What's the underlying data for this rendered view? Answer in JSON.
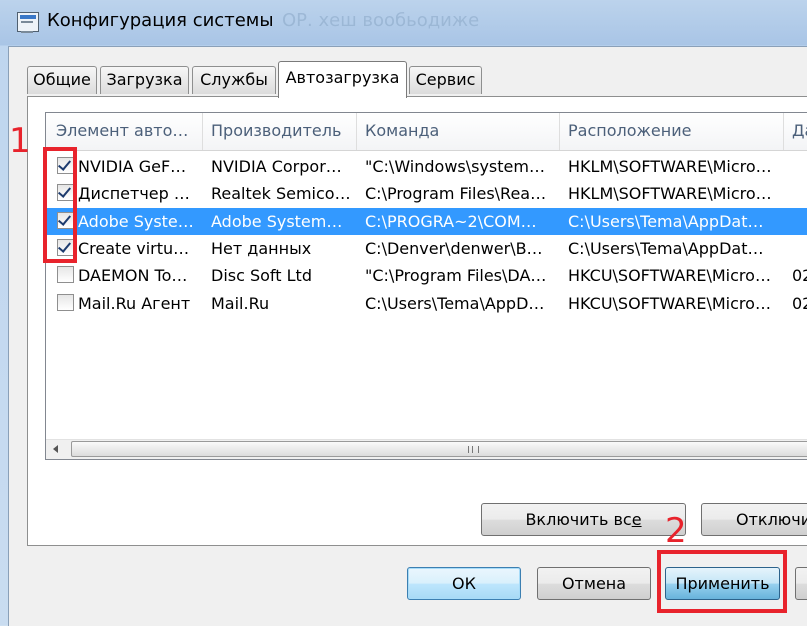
{
  "window": {
    "title": "Конфигурация системы",
    "title_ghost": "ОР. хеш вообьодиже"
  },
  "tabs": [
    {
      "label": "Общие",
      "active": false
    },
    {
      "label": "Загрузка",
      "active": false
    },
    {
      "label": "Службы",
      "active": false
    },
    {
      "label": "Автозагрузка",
      "active": true
    },
    {
      "label": "Сервис",
      "active": false
    }
  ],
  "startup_list": {
    "columns": [
      "Элемент авто…",
      "Производитель",
      "Команда",
      "Расположение",
      "Да"
    ],
    "rows": [
      {
        "checked": true,
        "selected": false,
        "item": "NVIDIA GeF…",
        "maker": "NVIDIA Corpor…",
        "command": "\"C:\\Windows\\system…",
        "location": "HKLM\\SOFTWARE\\Micro…",
        "date": ""
      },
      {
        "checked": true,
        "selected": false,
        "item": "Диспетчер …",
        "maker": "Realtek Semico…",
        "command": "C:\\Program Files\\Rea…",
        "location": "HKLM\\SOFTWARE\\Micro…",
        "date": ""
      },
      {
        "checked": true,
        "selected": true,
        "item": "Adobe Syste…",
        "maker": "Adobe System…",
        "command": "C:\\PROGRA~2\\COM…",
        "location": "C:\\Users\\Tema\\AppDat…",
        "date": ""
      },
      {
        "checked": true,
        "selected": false,
        "item": "Create virtu…",
        "maker": "Нет данных",
        "command": "C:\\Denver\\denwer\\B…",
        "location": "C:\\Users\\Tema\\AppDat…",
        "date": ""
      },
      {
        "checked": false,
        "selected": false,
        "item": "DAEMON To…",
        "maker": "Disc Soft Ltd",
        "command": "\"C:\\Program Files\\DA…",
        "location": "HKCU\\SOFTWARE\\Micro…",
        "date": "02"
      },
      {
        "checked": false,
        "selected": false,
        "item": "Mail.Ru Агент",
        "maker": "Mail.Ru",
        "command": "C:\\Users\\Tema\\AppD…",
        "location": "HKCU\\SOFTWARE\\Micro…",
        "date": "02"
      }
    ],
    "scrollbar_grip": "III"
  },
  "panel_buttons": {
    "enable_all": "Включить все",
    "disable_all": "Отключить все"
  },
  "dialog_buttons": {
    "ok": "ОК",
    "cancel": "Отмена",
    "apply": "Применить"
  },
  "annotations": {
    "one": "1",
    "two": "2",
    "color": "#e8232c"
  },
  "colors": {
    "selection": "#3399ff",
    "header_text": "#4c607a"
  }
}
